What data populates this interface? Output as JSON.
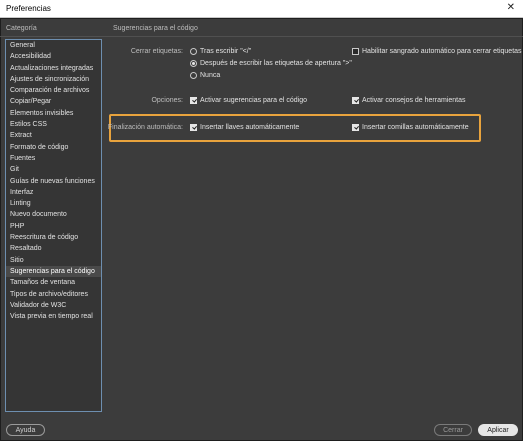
{
  "window": {
    "title": "Preferencias",
    "close_glyph": "✕"
  },
  "sidebar": {
    "header": "Categoría",
    "items": [
      "General",
      "Accesibilidad",
      "Actualizaciones integradas",
      "Ajustes de sincronización",
      "Comparación de archivos",
      "Copiar/Pegar",
      "Elementos invisibles",
      "Estilos CSS",
      "Extract",
      "Formato de código",
      "Fuentes",
      "Git",
      "Guías de nuevas funciones",
      "Interfaz",
      "Linting",
      "Nuevo documento",
      "PHP",
      "Reescritura de código",
      "Resaltado",
      "Sitio",
      "Sugerencias para el código",
      "Tamaños de ventana",
      "Tipos de archivo/editores",
      "Validador de W3C",
      "Vista previa en tiempo real"
    ],
    "selected": "Sugerencias para el código"
  },
  "panel": {
    "header": "Sugerencias para el código",
    "cerrar_etiquetas": {
      "label": "Cerrar etiquetas:",
      "option_after_typing": "Tras escribir \"</\"",
      "option_after_open_tag": "Después de escribir las etiquetas de apertura \">\"",
      "option_never": "Nunca",
      "selected": "option_after_open_tag"
    },
    "indent_closing": {
      "label": "Habilitar sangrado automático para cerrar etiquetas",
      "checked": false
    },
    "opciones": {
      "label": "Opciones:",
      "enable_hints": {
        "label": "Activar sugerencias para el código",
        "checked": true
      },
      "enable_tooltips": {
        "label": "Activar consejos de herramientas",
        "checked": true
      }
    },
    "finalizacion": {
      "label": "Finalización automática:",
      "insert_braces": {
        "label": "Insertar llaves automáticamente",
        "checked": true
      },
      "insert_quotes": {
        "label": "Insertar comillas automáticamente",
        "checked": true
      }
    }
  },
  "buttons": {
    "help": "Ayuda",
    "cancel": "Cerrar",
    "apply": "Aplicar"
  },
  "colors": {
    "highlight": "#e8a33d",
    "background": "#3c3c3c",
    "selection": "#4a4a4a"
  }
}
